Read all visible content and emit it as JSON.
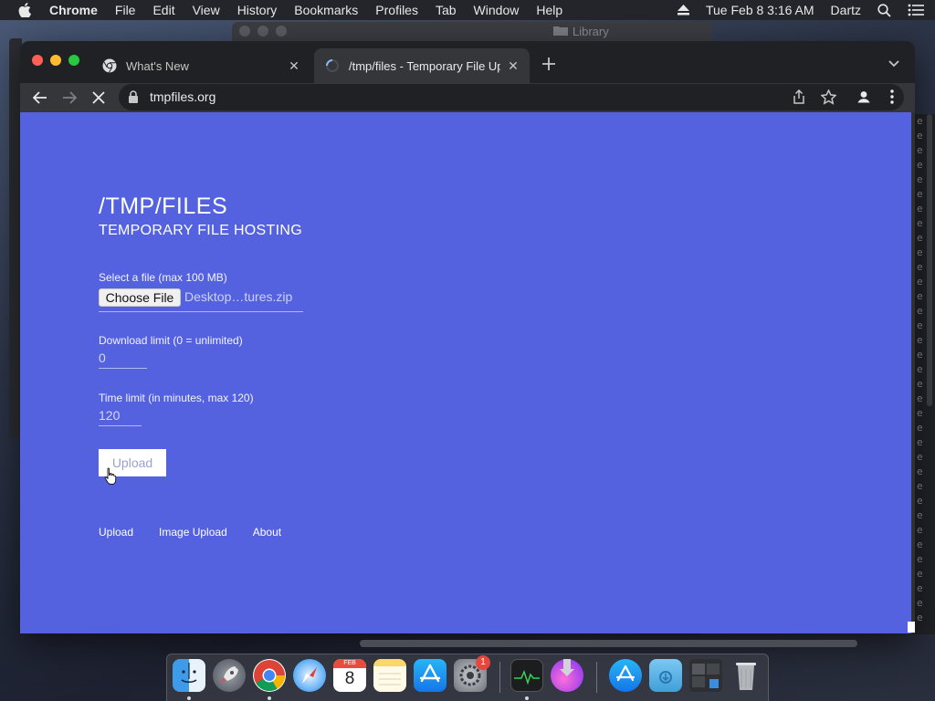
{
  "menubar": {
    "app_name": "Chrome",
    "items": [
      "File",
      "Edit",
      "View",
      "History",
      "Bookmarks",
      "Profiles",
      "Tab",
      "Window",
      "Help"
    ],
    "clock": "Tue Feb 8  3:16 AM",
    "user": "Dartz"
  },
  "background_window": {
    "title": "Library"
  },
  "browser": {
    "tabs": [
      {
        "title": "What's New",
        "icon": "chrome-icon",
        "active": false
      },
      {
        "title": "/tmp/files - Temporary File Upl",
        "icon": "loading-spinner-icon",
        "active": true
      }
    ],
    "url": "tmpfiles.org"
  },
  "page": {
    "title": "/TMP/FILES",
    "subtitle": "TEMPORARY FILE HOSTING",
    "file_label": "Select a file (max 100 MB)",
    "choose_file_label": "Choose File",
    "file_name": "Desktop…tures.zip",
    "download_limit_label": "Download limit (0 = unlimited)",
    "download_limit_value": "0",
    "time_limit_label": "Time limit (in minutes, max 120)",
    "time_limit_value": "120",
    "upload_button": "Upload",
    "footer_links": [
      "Upload",
      "Image Upload",
      "About"
    ],
    "background_color": "#5562e0"
  },
  "dock": {
    "calendar_month": "FEB",
    "calendar_day": "8",
    "badge_count": "1"
  }
}
